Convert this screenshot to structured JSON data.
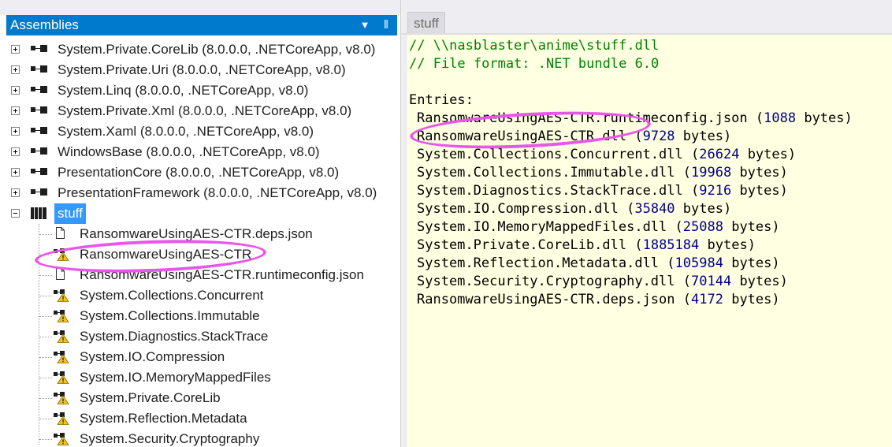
{
  "assemblies_panel": {
    "title": "Assemblies",
    "dropdown_glyph": "▼",
    "pin_glyph": "‖",
    "items": [
      {
        "label": "System.Private.CoreLib (8.0.0.0, .NETCoreApp, v8.0)",
        "icon": "assembly-icon"
      },
      {
        "label": "System.Private.Uri (8.0.0.0, .NETCoreApp, v8.0)",
        "icon": "assembly-icon"
      },
      {
        "label": "System.Linq (8.0.0.0, .NETCoreApp, v8.0)",
        "icon": "assembly-icon"
      },
      {
        "label": "System.Private.Xml (8.0.0.0, .NETCoreApp, v8.0)",
        "icon": "assembly-icon"
      },
      {
        "label": "System.Xaml (8.0.0.0, .NETCoreApp, v8.0)",
        "icon": "assembly-icon"
      },
      {
        "label": "WindowsBase (8.0.0.0, .NETCoreApp, v8.0)",
        "icon": "assembly-icon"
      },
      {
        "label": "PresentationCore (8.0.0.0, .NETCoreApp, v8.0)",
        "icon": "assembly-icon"
      },
      {
        "label": "PresentationFramework (8.0.0.0, .NETCoreApp, v8.0)",
        "icon": "assembly-icon"
      }
    ],
    "bundle": {
      "label": "stuff",
      "children": [
        {
          "label": "RansomwareUsingAES-CTR.deps.json",
          "icon": "file-icon"
        },
        {
          "label": "RansomwareUsingAES-CTR",
          "icon": "warning-assembly-icon"
        },
        {
          "label": "RansomwareUsingAES-CTR.runtimeconfig.json",
          "icon": "file-icon"
        },
        {
          "label": "System.Collections.Concurrent",
          "icon": "warning-assembly-icon"
        },
        {
          "label": "System.Collections.Immutable",
          "icon": "warning-assembly-icon"
        },
        {
          "label": "System.Diagnostics.StackTrace",
          "icon": "warning-assembly-icon"
        },
        {
          "label": "System.IO.Compression",
          "icon": "warning-assembly-icon"
        },
        {
          "label": "System.IO.MemoryMappedFiles",
          "icon": "warning-assembly-icon"
        },
        {
          "label": "System.Private.CoreLib",
          "icon": "warning-assembly-icon"
        },
        {
          "label": "System.Reflection.Metadata",
          "icon": "warning-assembly-icon"
        },
        {
          "label": "System.Security.Cryptography",
          "icon": "warning-assembly-icon"
        }
      ]
    }
  },
  "editor": {
    "tab_label": "stuff",
    "comments": [
      "// \\\\nasblaster\\anime\\stuff.dll",
      "// File format: .NET bundle 6.0"
    ],
    "entries_heading": "Entries:",
    "entries": [
      {
        "name": "RansomwareUsingAES-CTR.runtimeconfig.json",
        "size": "1088",
        "unit": "bytes"
      },
      {
        "name": "RansomwareUsingAES-CTR.dll",
        "size": "9728",
        "unit": "bytes"
      },
      {
        "name": "System.Collections.Concurrent.dll",
        "size": "26624",
        "unit": "bytes"
      },
      {
        "name": "System.Collections.Immutable.dll",
        "size": "19968",
        "unit": "bytes"
      },
      {
        "name": "System.Diagnostics.StackTrace.dll",
        "size": "9216",
        "unit": "bytes"
      },
      {
        "name": "System.IO.Compression.dll",
        "size": "35840",
        "unit": "bytes"
      },
      {
        "name": "System.IO.MemoryMappedFiles.dll",
        "size": "25088",
        "unit": "bytes"
      },
      {
        "name": "System.Private.CoreLib.dll",
        "size": "1885184",
        "unit": "bytes"
      },
      {
        "name": "System.Reflection.Metadata.dll",
        "size": "105984",
        "unit": "bytes"
      },
      {
        "name": "System.Security.Cryptography.dll",
        "size": "70144",
        "unit": "bytes"
      },
      {
        "name": "RansomwareUsingAES-CTR.deps.json",
        "size": "4172",
        "unit": "bytes"
      }
    ]
  },
  "colors": {
    "header_blue": "#007acc",
    "selection_blue": "#3399ff",
    "editor_background": "#ffffe1",
    "comment_green": "#008000",
    "number_navy": "#00008b",
    "annotation_pink": "#ea55ea"
  }
}
